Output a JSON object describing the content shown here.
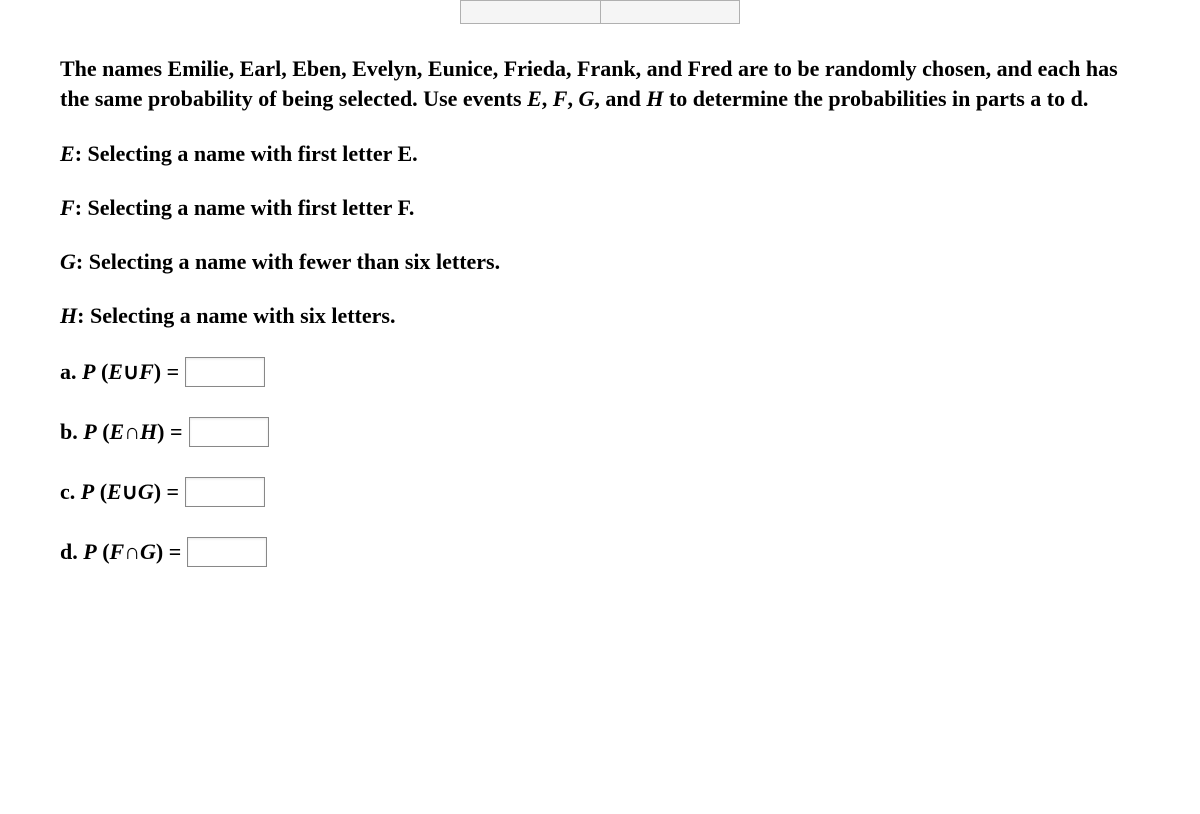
{
  "topInputs": {
    "left": "",
    "right": ""
  },
  "problem": {
    "intro_part1": "The names Emilie, Earl, Eben, Evelyn, Eunice, Frieda, Frank, and Fred are to be randomly chosen, and each has the same probability of being selected. Use events ",
    "var_E": "E",
    "sep1": ", ",
    "var_F": "F",
    "sep2": ", ",
    "var_G": "G",
    "sep3": ", and ",
    "var_H": "H",
    "intro_part2": " to determine the probabilities in parts a to d."
  },
  "events": {
    "E": {
      "label": "E",
      "colon": ": ",
      "desc": "Selecting a name with first letter E."
    },
    "F": {
      "label": "F",
      "colon": ": ",
      "desc": "Selecting a name with first letter F."
    },
    "G": {
      "label": "G",
      "colon": ": ",
      "desc": "Selecting a name with fewer than six letters."
    },
    "H": {
      "label": "H",
      "colon": ": ",
      "desc": "Selecting a name with six letters."
    }
  },
  "questions": {
    "a": {
      "prefix": "a. ",
      "P": "P",
      "open": " (",
      "v1": "E",
      "op": "∪",
      "v2": "F",
      "close": ") = "
    },
    "b": {
      "prefix": "b. ",
      "P": "P",
      "open": " (",
      "v1": "E",
      "op": "∩",
      "v2": "H",
      "close": ") = "
    },
    "c": {
      "prefix": "c. ",
      "P": "P",
      "open": " (",
      "v1": "E",
      "op": "∪",
      "v2": "G",
      "close": ") = "
    },
    "d": {
      "prefix": "d. ",
      "P": "P",
      "open": " (",
      "v1": "F",
      "op": "∩",
      "v2": "G",
      "close": ") = "
    }
  },
  "answers": {
    "a": "",
    "b": "",
    "c": "",
    "d": ""
  }
}
